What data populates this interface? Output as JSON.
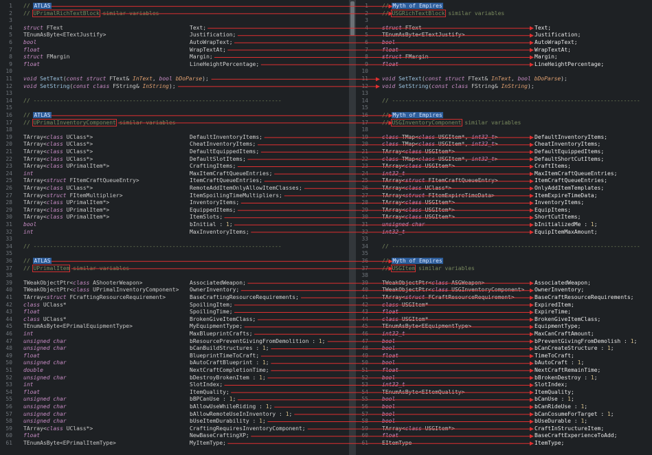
{
  "left": {
    "lines": [
      {
        "n": "1",
        "code": "// ATLAS",
        "kind": "comment",
        "hl": "ATLAS"
      },
      {
        "n": "2",
        "code": "// UPrimalRichTextBlock similar variables",
        "kind": "comment",
        "box": "UPrimalRichTextBlock"
      },
      {
        "n": "3",
        "code": "",
        "kind": "blank"
      },
      {
        "n": "4",
        "code": "struct FText",
        "mem": "Text;"
      },
      {
        "n": "5",
        "code": "TEnumAsByte<ETextJustify>",
        "mem": "Justification;"
      },
      {
        "n": "6",
        "code": "bool",
        "mem": "AutoWrapText;",
        "kw": true
      },
      {
        "n": "7",
        "code": "float",
        "mem": "WrapTextAt;",
        "kw": true
      },
      {
        "n": "8",
        "code": "struct FMargin",
        "mem": "Margin;"
      },
      {
        "n": "9",
        "code": "float",
        "mem": "LineHeightPercentage;",
        "kw": true
      },
      {
        "n": "10",
        "code": "",
        "kind": "blank"
      },
      {
        "n": "11",
        "code": "void SetText(const struct FText& InText, bool bDoParse);",
        "kind": "fn"
      },
      {
        "n": "12",
        "code": "void SetString(const class FString& InString);",
        "kind": "fn"
      },
      {
        "n": "13",
        "code": "",
        "kind": "blank"
      },
      {
        "n": "14",
        "code": "// ---------------------------------------------------------------------------",
        "kind": "comment"
      },
      {
        "n": "15",
        "code": "",
        "kind": "blank"
      },
      {
        "n": "16",
        "code": "// ATLAS",
        "kind": "comment",
        "hl": "ATLAS"
      },
      {
        "n": "17",
        "code": "// UPrimalInventoryComponent similar variables",
        "kind": "comment",
        "box": "UPrimalInventoryComponent"
      },
      {
        "n": "18",
        "code": "",
        "kind": "blank"
      },
      {
        "n": "19",
        "code": "TArray<class UClass*>",
        "mem": "DefaultInventoryItems;"
      },
      {
        "n": "20",
        "code": "TArray<class UClass*>",
        "mem": "CheatInventoryItems;"
      },
      {
        "n": "21",
        "code": "TArray<class UClass*>",
        "mem": "DefaultEquippedItems;"
      },
      {
        "n": "22",
        "code": "TArray<class UClass*>",
        "mem": "DefaultSlotItems;"
      },
      {
        "n": "23",
        "code": "TArray<class UPrimalItem*>",
        "mem": "CraftingItems;"
      },
      {
        "n": "24",
        "code": "int",
        "mem": "MaxItemCraftQueueEntries;",
        "kw": true
      },
      {
        "n": "25",
        "code": "TArray<struct FItemCraftQueueEntry>",
        "mem": "ItemCraftQueueEntries;"
      },
      {
        "n": "26",
        "code": "TArray<class UClass*>",
        "mem": "RemoteAddItemOnlyAllowItemClasses;"
      },
      {
        "n": "27",
        "code": "TArray<struct FItemMultiplier>",
        "mem": "ItemSpoilingTimeMultipliers;"
      },
      {
        "n": "28",
        "code": "TArray<class UPrimalItem*>",
        "mem": "InventoryItems;"
      },
      {
        "n": "29",
        "code": "TArray<class UPrimalItem*>",
        "mem": "EquippedItems;"
      },
      {
        "n": "30",
        "code": "TArray<class UPrimalItem*>",
        "mem": "ItemSlots;"
      },
      {
        "n": "31",
        "code": "bool",
        "mem": "bInitial : 1;",
        "kw": true
      },
      {
        "n": "32",
        "code": "int",
        "mem": "MaxInventoryItems;",
        "kw": true
      },
      {
        "n": "33",
        "code": "",
        "kind": "blank"
      },
      {
        "n": "34",
        "code": "// ---------------------------------------------------------------------------",
        "kind": "comment"
      },
      {
        "n": "35",
        "code": "",
        "kind": "blank"
      },
      {
        "n": "36",
        "code": "// ATLAS",
        "kind": "comment",
        "hl": "ATLAS"
      },
      {
        "n": "37",
        "code": "// UPrimalItem similar variables",
        "kind": "comment",
        "box": "UPrimalItem"
      },
      {
        "n": "38",
        "code": "",
        "kind": "blank"
      },
      {
        "n": "39",
        "code": "TWeakObjectPtr<class AShooterWeapon>",
        "mem": "AssociatedWeapon;"
      },
      {
        "n": "40",
        "code": "TWeakObjectPtr<class UPrimalInventoryComponent>",
        "mem": "OwnerInventory;"
      },
      {
        "n": "41",
        "code": "TArray<struct FCraftingResourceRequirement>",
        "mem": "BaseCraftingResourceRequirements;"
      },
      {
        "n": "42",
        "code": "class UClass*",
        "mem": "SpoilingItem;",
        "kw": true
      },
      {
        "n": "43",
        "code": "float",
        "mem": "SpoilingTime;",
        "kw": true
      },
      {
        "n": "44",
        "code": "class UClass*",
        "mem": "BrokenGiveItemClass;",
        "kw": true
      },
      {
        "n": "45",
        "code": "TEnumAsByte<EPrimalEquipmentType>",
        "mem": "MyEquipmentType;"
      },
      {
        "n": "46",
        "code": "int",
        "mem": "MaxBlueprintCrafts;",
        "kw": true
      },
      {
        "n": "47",
        "code": "unsigned char",
        "mem": "bResourcePreventGivingFromDemolition : 1;",
        "kw": true
      },
      {
        "n": "48",
        "code": "unsigned char",
        "mem": "bCanBuildStructures : 1;",
        "kw": true
      },
      {
        "n": "49",
        "code": "float",
        "mem": "BlueprintTimeToCraft;",
        "kw": true
      },
      {
        "n": "50",
        "code": "unsigned char",
        "mem": "bAutoCraftBlueprint : 1;",
        "kw": true
      },
      {
        "n": "51",
        "code": "double",
        "mem": "NextCraftCompletionTime;",
        "kw": true
      },
      {
        "n": "52",
        "code": "unsigned char",
        "mem": "bDestroyBrokenItem : 1;",
        "kw": true
      },
      {
        "n": "53",
        "code": "int",
        "mem": "SlotIndex;",
        "kw": true
      },
      {
        "n": "54",
        "code": "float",
        "mem": "ItemQuality;",
        "kw": true
      },
      {
        "n": "55",
        "code": "unsigned char",
        "mem": "bBPCanUse : 1;",
        "kw": true
      },
      {
        "n": "56",
        "code": "unsigned char",
        "mem": "bAllowUseWhileRiding : 1;",
        "kw": true
      },
      {
        "n": "57",
        "code": "unsigned char",
        "mem": "bAllowRemoteUseInInventory : 1;",
        "kw": true
      },
      {
        "n": "58",
        "code": "unsigned char",
        "mem": "bUseItemDurability : 1;",
        "kw": true
      },
      {
        "n": "59",
        "code": "TArray<class UClass*>",
        "mem": "CraftingRequiresInventoryComponent;"
      },
      {
        "n": "60",
        "code": "float",
        "mem": "NewBaseCraftingXP;",
        "kw": true
      },
      {
        "n": "61",
        "code": "TEnumAsByte<EPrimalItemType>",
        "mem": "MyItemType;"
      }
    ]
  },
  "right": {
    "lines": [
      {
        "n": "1",
        "code": "// Myth of Empires",
        "kind": "comment",
        "hl": "Myth of Empires"
      },
      {
        "n": "2",
        "code": "// USGRichTextBlock similar variables",
        "kind": "comment",
        "box": "USGRichTextBlock"
      },
      {
        "n": "3",
        "code": "",
        "kind": "blank"
      },
      {
        "n": "4",
        "code": "struct FText",
        "mem": "Text;"
      },
      {
        "n": "5",
        "code": "TEnumAsByte<ETextJustify>",
        "mem": "Justification;"
      },
      {
        "n": "6",
        "code": "bool",
        "mem": "AutoWrapText;",
        "kw": true
      },
      {
        "n": "7",
        "code": "float",
        "mem": "WrapTextAt;",
        "kw": true
      },
      {
        "n": "8",
        "code": "struct FMargin",
        "mem": "Margin;"
      },
      {
        "n": "9",
        "code": "float",
        "mem": "LineHeightPercentage;",
        "kw": true
      },
      {
        "n": "10",
        "code": "",
        "kind": "blank"
      },
      {
        "n": "11",
        "code": "void SetText(const struct FText& InText, bool bDoParse);",
        "kind": "fn"
      },
      {
        "n": "12",
        "code": "void SetString(const class FString& InString);",
        "kind": "fn"
      },
      {
        "n": "13",
        "code": "",
        "kind": "blank"
      },
      {
        "n": "14",
        "code": "// ---------------------------------------------------------------------------",
        "kind": "comment"
      },
      {
        "n": "15",
        "code": "",
        "kind": "blank"
      },
      {
        "n": "16",
        "code": "// Myth of Empires",
        "kind": "comment",
        "hl": "Myth of Empires"
      },
      {
        "n": "17",
        "code": "// USGInventoryComponent similar variables",
        "kind": "comment",
        "box": "USGInventoryComponent"
      },
      {
        "n": "18",
        "code": "",
        "kind": "blank"
      },
      {
        "n": "19",
        "code": "class TMap<class USGItem*, int32_t>",
        "mem": "DefaultInventoryItems;",
        "kw": true
      },
      {
        "n": "20",
        "code": "class TMap<class USGItem*, int32_t>",
        "mem": "CheatInventoryItems;",
        "kw": true
      },
      {
        "n": "21",
        "code": "TArray<class USGItem*>",
        "mem": "DefaultEquippedItems;"
      },
      {
        "n": "22",
        "code": "class TMap<class USGItem*, int32_t>",
        "mem": "DefaultShortCutItems;",
        "kw": true
      },
      {
        "n": "23",
        "code": "TArray<class USGItem*>",
        "mem": "CraftItems;"
      },
      {
        "n": "24",
        "code": "int32_t",
        "mem": "MaxItemCraftQueueEntries;",
        "kw": true
      },
      {
        "n": "25",
        "code": "TArray<struct FItemCraftQueueEntry>",
        "mem": "ItemCraftQueueEntries;"
      },
      {
        "n": "26",
        "code": "TArray<class UClass*>",
        "mem": "OnlyAddItemTemplates;"
      },
      {
        "n": "27",
        "code": "TArray<struct FItemExpireTimeData>",
        "mem": "ItemExpireTimeData;"
      },
      {
        "n": "28",
        "code": "TArray<class USGItem*>",
        "mem": "InventoryItems;"
      },
      {
        "n": "29",
        "code": "TArray<class USGItem*>",
        "mem": "EquipItems;"
      },
      {
        "n": "30",
        "code": "TArray<class USGItem*>",
        "mem": "ShortCutItems;"
      },
      {
        "n": "31",
        "code": "unsigned char",
        "mem": "bInitializedMe : 1;",
        "kw": true
      },
      {
        "n": "32",
        "code": "int32_t",
        "mem": "EquipItemMaxAmount;",
        "kw": true
      },
      {
        "n": "33",
        "code": "",
        "kind": "blank"
      },
      {
        "n": "34",
        "code": "// ---------------------------------------------------------------------------",
        "kind": "comment"
      },
      {
        "n": "35",
        "code": "",
        "kind": "blank"
      },
      {
        "n": "36",
        "code": "// Myth of Empires",
        "kind": "comment",
        "hl": "Myth of Empires"
      },
      {
        "n": "37",
        "code": "// USGItem similar variables",
        "kind": "comment",
        "box": "USGItem"
      },
      {
        "n": "38",
        "code": "",
        "kind": "blank"
      },
      {
        "n": "39",
        "code": "TWeakObjectPtr<class ASGWeapon>",
        "mem": "AssociatedWeapon;"
      },
      {
        "n": "40",
        "code": "TWeakObjectPtr<class USGInventoryComponent>",
        "mem": "OwnerInventory;"
      },
      {
        "n": "41",
        "code": "TArray<struct FCraftResourceRequirement>",
        "mem": "BaseCraftResourceRequirements;"
      },
      {
        "n": "42",
        "code": "class USGItem*",
        "mem": "ExpiredItem;",
        "kw": true
      },
      {
        "n": "43",
        "code": "float",
        "mem": "ExpireTime;",
        "kw": true
      },
      {
        "n": "44",
        "code": "class USGItem*",
        "mem": "BrokenGiveItemClass;",
        "kw": true
      },
      {
        "n": "45",
        "code": "TEnumAsByte<EEquipmentType>",
        "mem": "EquipmentType;"
      },
      {
        "n": "46",
        "code": "int32_t",
        "mem": "MaxCanCraftAmount;",
        "kw": true
      },
      {
        "n": "47",
        "code": "bool",
        "mem": "bPreventGivingFromDemolish : 1;",
        "kw": true
      },
      {
        "n": "48",
        "code": "bool",
        "mem": "bCanCreateStructure : 1;",
        "kw": true
      },
      {
        "n": "49",
        "code": "float",
        "mem": "TimeToCraft;",
        "kw": true
      },
      {
        "n": "50",
        "code": "bool",
        "mem": "bAutoCraft : 1;",
        "kw": true
      },
      {
        "n": "51",
        "code": "float",
        "mem": "NextCraftRemainTime;",
        "kw": true
      },
      {
        "n": "52",
        "code": "bool",
        "mem": "bBrokenDestroy : 1;",
        "kw": true
      },
      {
        "n": "53",
        "code": "int32_t",
        "mem": "SlotIndex;",
        "kw": true
      },
      {
        "n": "54",
        "code": "TEnumAsByte<EItemQuality>",
        "mem": "ItemQuality;"
      },
      {
        "n": "55",
        "code": "bool",
        "mem": "bCanUse : 1;",
        "kw": true
      },
      {
        "n": "56",
        "code": "bool",
        "mem": "bCanRideUse : 1;",
        "kw": true
      },
      {
        "n": "57",
        "code": "bool",
        "mem": "bCanCosumeForTarget : 1;",
        "kw": true
      },
      {
        "n": "58",
        "code": "bool",
        "mem": "bUseDurable : 1;",
        "kw": true
      },
      {
        "n": "59",
        "code": "TArray<class USGItem*>",
        "mem": "CraftInStructureItem;"
      },
      {
        "n": "60",
        "code": "float",
        "mem": "BaseCraftExperienceToAdd;",
        "kw": true
      },
      {
        "n": "61",
        "code": "EItemType",
        "mem": "ItemType;"
      }
    ]
  },
  "colors": {
    "arrow": "#e03030",
    "box": "#d23030",
    "highlight": "#2d5d9a",
    "comment": "#7a8a5e",
    "keyword": "#c98dc6"
  }
}
